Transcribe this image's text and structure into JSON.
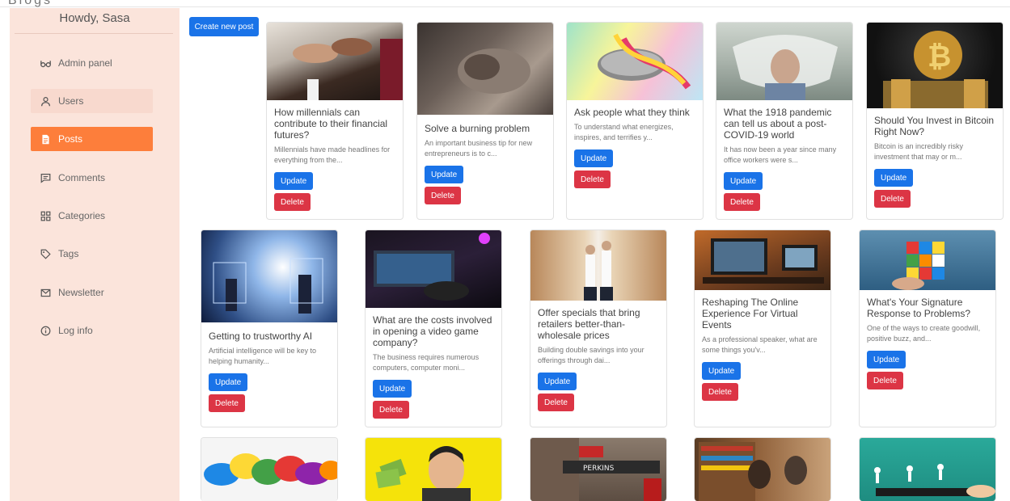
{
  "header": {
    "logo": "Blogs"
  },
  "sidebar": {
    "greeting": "Howdy, Sasa",
    "items": [
      {
        "label": "Admin panel",
        "icon": "glasses-icon"
      },
      {
        "label": "Users",
        "icon": "user-icon"
      },
      {
        "label": "Posts",
        "icon": "document-icon"
      },
      {
        "label": "Comments",
        "icon": "comment-icon"
      },
      {
        "label": "Categories",
        "icon": "grid-icon"
      },
      {
        "label": "Tags",
        "icon": "tag-icon"
      },
      {
        "label": "Newsletter",
        "icon": "mail-icon"
      },
      {
        "label": "Log info",
        "icon": "info-icon"
      }
    ]
  },
  "actions": {
    "create_label": "Create new post"
  },
  "buttons": {
    "update": "Update",
    "delete": "Delete"
  },
  "posts": [
    {
      "title": "How millennials can contribute to their financial futures?",
      "excerpt": "Millennials have made headlines for everything from the..."
    },
    {
      "title": "Solve a burning problem",
      "excerpt": "An important business tip for new entrepreneurs is to c..."
    },
    {
      "title": "Ask people what they think",
      "excerpt": "To understand what energizes, inspires, and terrifies y..."
    },
    {
      "title": "What the 1918 pandemic can tell us about a post-COVID-19 world",
      "excerpt": "It has now been a year since many office workers were s..."
    },
    {
      "title": "Should You Invest in Bitcoin Right Now?",
      "excerpt": "Bitcoin is an incredibly risky investment that may or m..."
    },
    {
      "title": "Getting to trustworthy AI",
      "excerpt": "Artificial intelligence will be key to helping humanity..."
    },
    {
      "title": "What are the costs involved in opening a video game company?",
      "excerpt": "The business requires numerous computers, computer moni..."
    },
    {
      "title": "Offer specials that bring retailers better-than-wholesale prices",
      "excerpt": "Building double savings into your offerings through dai..."
    },
    {
      "title": "Reshaping The Online Experience For Virtual Events",
      "excerpt": "As a professional speaker, what are some things you'v..."
    },
    {
      "title": "What's Your Signature Response to Problems?",
      "excerpt": "One of the ways to create goodwill, positive buzz, and..."
    }
  ],
  "image_texts": {
    "store_sign": "PERKINS"
  }
}
